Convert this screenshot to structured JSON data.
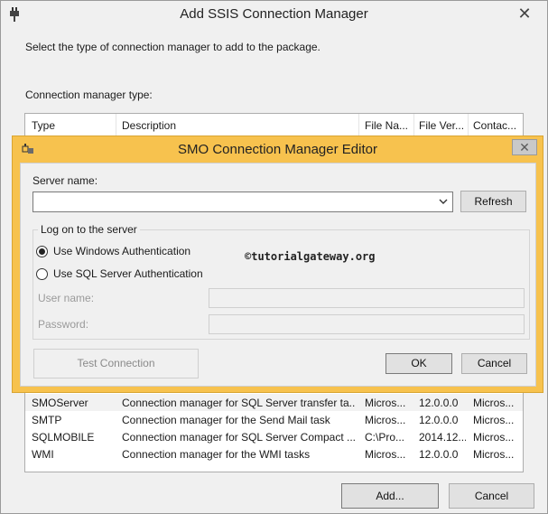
{
  "window": {
    "title": "Add SSIS Connection Manager",
    "close_glyph": "✕",
    "icon": "ssis-plug-icon"
  },
  "instruction": "Select the type of connection manager to add to the package.",
  "type_label": "Connection manager type:",
  "table": {
    "headers": [
      "Type",
      "Description",
      "File Na...",
      "File Ver...",
      "Contac..."
    ],
    "rows": [
      [
        "SMOServer",
        "Connection manager for SQL Server transfer ta...",
        "Micros...",
        "12.0.0.0",
        "Micros..."
      ],
      [
        "SMTP",
        "Connection manager for the Send Mail task",
        "Micros...",
        "12.0.0.0",
        "Micros..."
      ],
      [
        "SQLMOBILE",
        "Connection manager for SQL Server Compact ...",
        "C:\\Pro...",
        "2014.12...",
        "Micros..."
      ],
      [
        "WMI",
        "Connection manager for the WMI tasks",
        "Micros...",
        "12.0.0.0",
        "Micros..."
      ]
    ]
  },
  "footer": {
    "add_label": "Add...",
    "cancel_label": "Cancel"
  },
  "modal": {
    "title": "SMO Connection Manager Editor",
    "close_glyph": "✕",
    "server_name_label": "Server name:",
    "server_name_value": "",
    "refresh_label": "Refresh",
    "logon_group_label": "Log on to the server",
    "auth_windows_label": "Use Windows Authentication",
    "auth_sql_label": "Use SQL Server Authentication",
    "selected_auth": "windows",
    "username_label": "User name:",
    "password_label": "Password:",
    "test_connection_label": "Test  Connection",
    "ok_label": "OK",
    "cancel_label": "Cancel",
    "watermark": "©tutorialgateway.org"
  },
  "colors": {
    "modal_frame": "#f7c24e",
    "dialog_bg": "#f0f0f0",
    "list_bg": "#ffffff"
  }
}
